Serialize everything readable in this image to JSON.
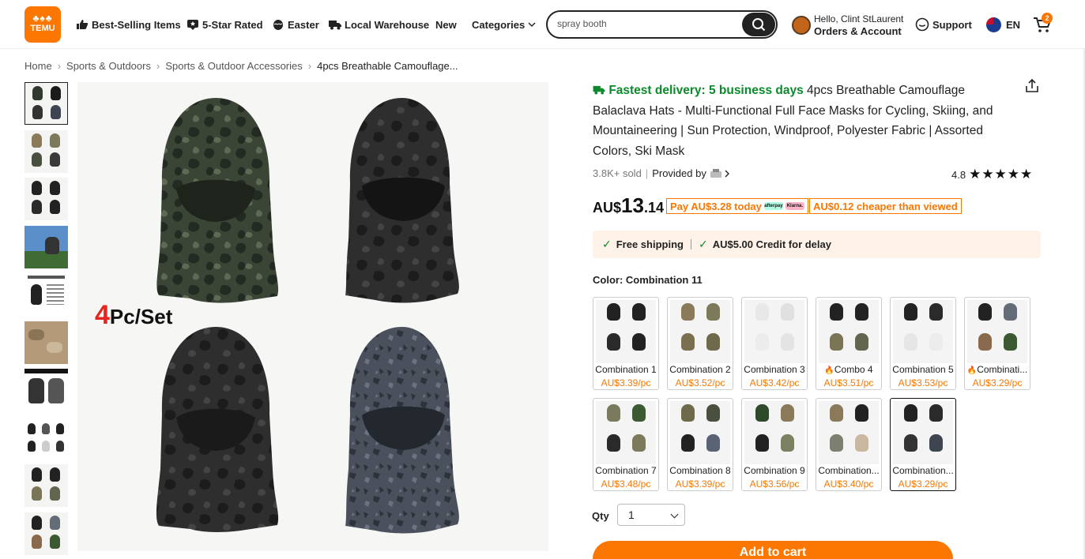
{
  "header": {
    "logo_text": "TEMU",
    "nav": [
      {
        "label": "Best-Selling Items",
        "icon": "thumbs-up-icon"
      },
      {
        "label": "5-Star Rated",
        "icon": "star-badge-icon"
      },
      {
        "label": "Easter",
        "icon": "easter-egg-icon"
      },
      {
        "label": "Local Warehouse",
        "icon": "truck-icon"
      },
      {
        "label": "New"
      },
      {
        "label": "Categories",
        "icon": "chevron-down-icon"
      }
    ],
    "search": {
      "value": "spray booth",
      "icon": "search-icon"
    },
    "account": {
      "greeting": "Hello, Clint StLaurent",
      "label": "Orders & Account"
    },
    "support_label": "Support",
    "language": "EN",
    "cart_count": "2"
  },
  "breadcrumb": [
    "Home",
    "Sports & Outdoors",
    "Sports & Outdoor Accessories",
    "4pcs Breathable Camouflage..."
  ],
  "gallery": {
    "main_overlay_number": "4",
    "main_overlay_text": "Pc/Set",
    "thumbnail_count": 10
  },
  "product": {
    "fastest_delivery": "Fastest delivery: 5 business days",
    "title": "4pcs Breathable Camouflage Balaclava Hats - Multi-Functional Full Face Masks for Cycling, Skiing, and Mountaineering | Sun Protection, Windproof, Polyester Fabric | Assorted Colors, Ski Mask",
    "sold": "3.8K+ sold",
    "provided_by": "Provided by",
    "rating_value": "4.8",
    "stars": "★★★★★",
    "price_currency": "AU$",
    "price_int": "13",
    "price_dec": ".14",
    "pay_today": "Pay AU$3.28 today",
    "afterpay_label": "afterpay",
    "klarna_label": "Klarna.",
    "cheaper_tag": "AU$0.12 cheaper than viewed",
    "free_shipping": "Free shipping",
    "credit_delay": "AU$5.00 Credit for delay",
    "color_label": "Color:",
    "color_value": "Combination 11",
    "variants": [
      {
        "name": "Combination 1",
        "price": "AU$3.39/pc"
      },
      {
        "name": "Combination 2",
        "price": "AU$3.52/pc"
      },
      {
        "name": "Combination 3",
        "price": "AU$3.42/pc"
      },
      {
        "name": "Combo 4",
        "price": "AU$3.51/pc",
        "hot": true
      },
      {
        "name": "Combination 5",
        "price": "AU$3.53/pc"
      },
      {
        "name": "Combinati...",
        "price": "AU$3.29/pc",
        "hot": true
      },
      {
        "name": "Combination 7",
        "price": "AU$3.48/pc"
      },
      {
        "name": "Combination 8",
        "price": "AU$3.39/pc"
      },
      {
        "name": "Combination 9",
        "price": "AU$3.56/pc"
      },
      {
        "name": "Combination...",
        "price": "AU$3.40/pc"
      },
      {
        "name": "Combination...",
        "price": "AU$3.29/pc",
        "selected": true
      }
    ],
    "qty_label": "Qty",
    "qty_value": "1",
    "add_to_cart": "Add to cart"
  }
}
